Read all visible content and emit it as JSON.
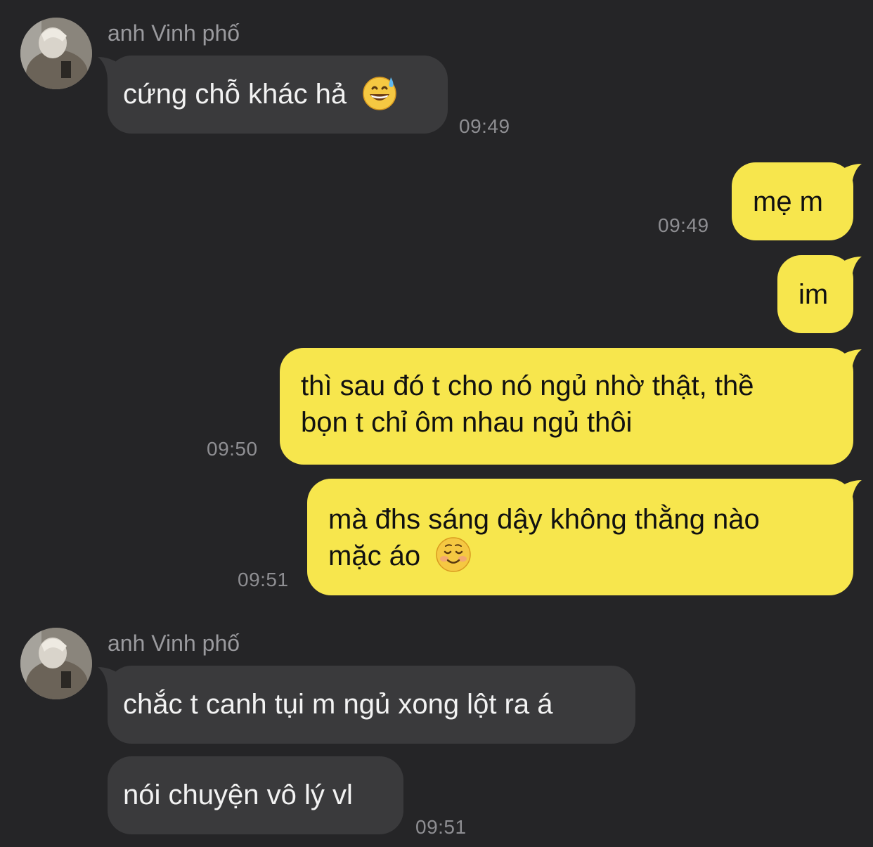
{
  "colors": {
    "background": "#252527",
    "incoming_bubble": "#3a3a3c",
    "outgoing_bubble": "#f7e64d",
    "timestamp": "#8e8e92",
    "sender_name": "#9a9a9e"
  },
  "messages": [
    {
      "sender": "anh Vinh phố",
      "direction": "incoming",
      "text": "cứng chỗ khác hả",
      "emoji": "grinning-sweat-emoji",
      "time": "09:49"
    },
    {
      "direction": "outgoing",
      "text": "mẹ m",
      "time": "09:49"
    },
    {
      "direction": "outgoing",
      "text": "im"
    },
    {
      "direction": "outgoing",
      "lines": [
        "thì sau đó t cho nó ngủ nhờ thật, thề",
        "bọn t chỉ ôm nhau ngủ thôi"
      ],
      "time": "09:50"
    },
    {
      "direction": "outgoing",
      "lines": [
        "mà đhs sáng dậy không thằng nào",
        "mặc áo"
      ],
      "emoji": "smiling-face-emoji",
      "time": "09:51"
    },
    {
      "sender": "anh Vinh phố",
      "direction": "incoming",
      "text": "chắc t canh tụi m ngủ xong lột ra á"
    },
    {
      "direction": "incoming",
      "text": "nói chuyện vô lý vl",
      "time": "09:51"
    }
  ]
}
